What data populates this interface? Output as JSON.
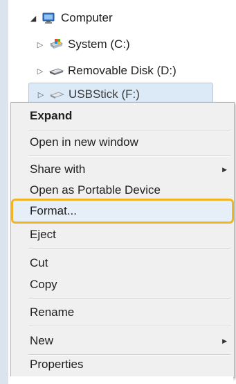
{
  "tree": {
    "computer": {
      "label": "Computer"
    },
    "system": {
      "label": "System (C:)"
    },
    "removable": {
      "label": "Removable Disk (D:)"
    },
    "usb": {
      "label": "USBStick (F:)"
    }
  },
  "context_menu": {
    "highlighted_item": "Format...",
    "highlight_color": "#f0b526",
    "items": [
      {
        "label": "Expand"
      },
      {
        "label": "Open in new window"
      },
      {
        "label": "Share with"
      },
      {
        "label": "Open as Portable Device"
      },
      {
        "label": "Format..."
      },
      {
        "label": "Eject"
      },
      {
        "label": "Cut"
      },
      {
        "label": "Copy"
      },
      {
        "label": "Rename"
      },
      {
        "label": "New"
      },
      {
        "label": "Properties"
      }
    ]
  }
}
